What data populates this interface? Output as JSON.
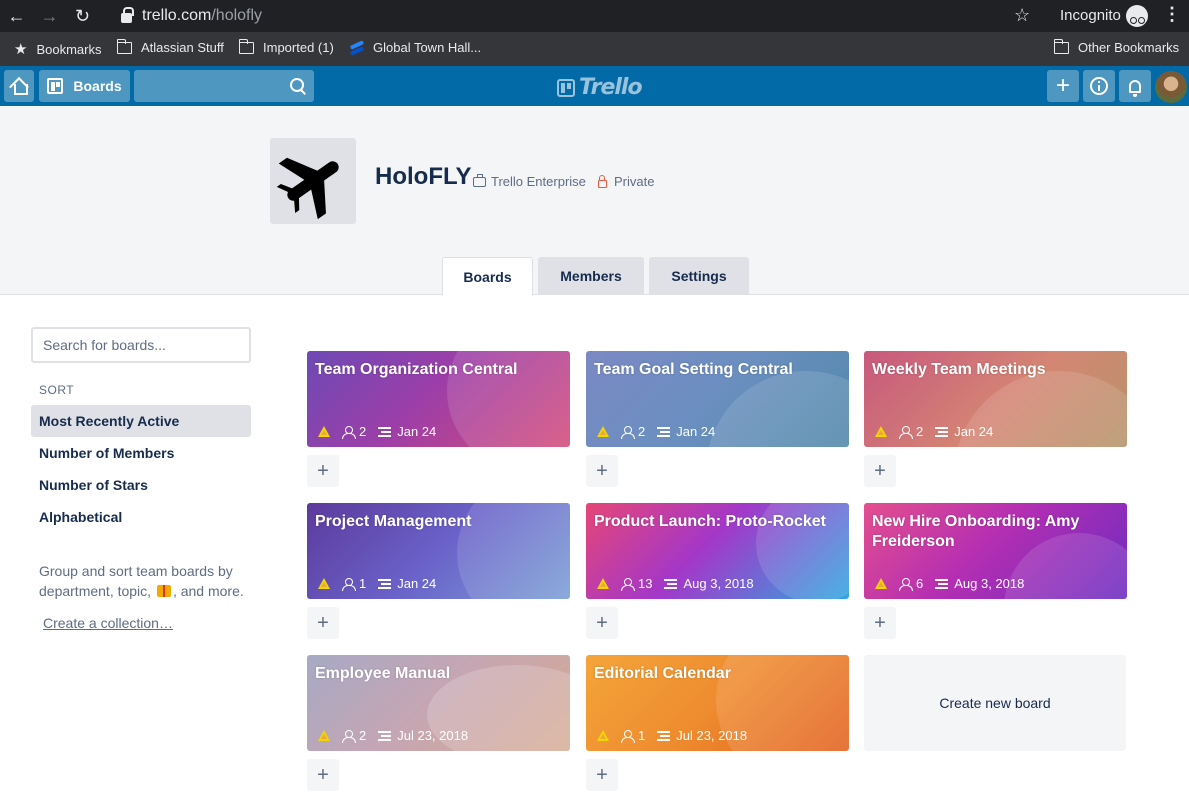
{
  "browser": {
    "url_host": "trello.com",
    "url_path": "/holofly",
    "incognito_label": "Incognito",
    "bookmarks": [
      {
        "label": "Bookmarks",
        "icon": "star-icon"
      },
      {
        "label": "Atlassian Stuff",
        "icon": "folder-icon"
      },
      {
        "label": "Imported (1)",
        "icon": "folder-icon"
      },
      {
        "label": "Global Town Hall...",
        "icon": "confluence-icon"
      }
    ],
    "other_bookmarks": "Other Bookmarks"
  },
  "header": {
    "boards_label": "Boards",
    "logo_text": "Trello",
    "colors": {
      "header_bg": "#026aa7"
    }
  },
  "team": {
    "name": "HoloFLY",
    "plan": "Trello Enterprise",
    "visibility": "Private",
    "logo_icon": "airplane-icon"
  },
  "tabs": [
    {
      "label": "Boards",
      "active": true
    },
    {
      "label": "Members",
      "active": false
    },
    {
      "label": "Settings",
      "active": false
    }
  ],
  "sidebar": {
    "search_placeholder": "Search for boards...",
    "sort_heading": "SORT",
    "sort_options": [
      "Most Recently Active",
      "Number of Members",
      "Number of Stars",
      "Alphabetical"
    ],
    "collection_text_1": "Group and sort team boards by department, topic,",
    "collection_text_2": ", and more.",
    "create_collection": "Create a collection…"
  },
  "boards": [
    {
      "title": "Team Organization Central",
      "members": "2",
      "date": "Jan 24"
    },
    {
      "title": "Team Goal Setting Central",
      "members": "2",
      "date": "Jan 24"
    },
    {
      "title": "Weekly Team Meetings",
      "members": "2",
      "date": "Jan 24"
    },
    {
      "title": "Project Management",
      "members": "1",
      "date": "Jan 24"
    },
    {
      "title": "Product Launch: Proto-Rocket",
      "members": "13",
      "date": "Aug 3, 2018"
    },
    {
      "title": "New Hire Onboarding: Amy Freiderson",
      "members": "6",
      "date": "Aug 3, 2018"
    },
    {
      "title": "Employee Manual",
      "members": "2",
      "date": "Jul 23, 2018"
    },
    {
      "title": "Editorial Calendar",
      "members": "1",
      "date": "Jul 23, 2018"
    }
  ],
  "create_board_label": "Create new board"
}
